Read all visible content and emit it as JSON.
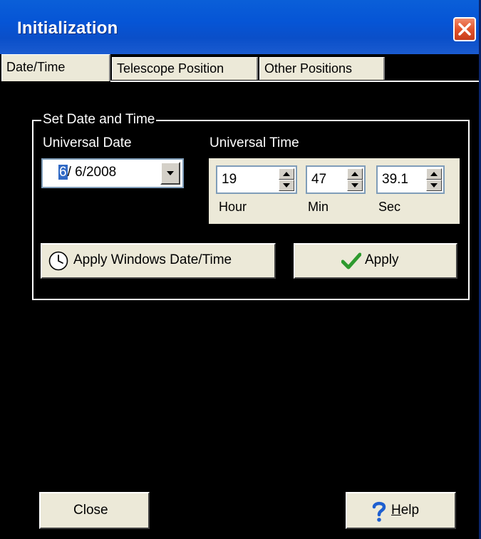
{
  "window": {
    "title": "Initialization"
  },
  "tabs": [
    {
      "label": "Date/Time",
      "active": true
    },
    {
      "label": "Telescope Position",
      "active": false
    },
    {
      "label": "Other Positions",
      "active": false
    }
  ],
  "group": {
    "legend": "Set Date and Time",
    "universal_date_label": "Universal Date",
    "universal_time_label": "Universal Time",
    "date": {
      "selected_part": "6",
      "rest": "/ 6/2008"
    },
    "time": {
      "hour": {
        "value": "19",
        "label": "Hour"
      },
      "min": {
        "value": "47",
        "label": "Min"
      },
      "sec": {
        "value": "39.1",
        "label": "Sec"
      }
    }
  },
  "buttons": {
    "apply_windows": "Apply Windows Date/Time",
    "apply": "Apply",
    "close": "Close",
    "help": "Help"
  },
  "icons": {
    "clock": "clock-icon",
    "check": "checkmark-icon",
    "help": "question-mark-icon",
    "close": "close-x-icon"
  },
  "colors": {
    "titlebar": "#0a5fd8",
    "background": "#000000",
    "panel": "#ece9d8",
    "close_button": "#e2542c",
    "check": "#2e9a2e",
    "help": "#1e5fd0"
  }
}
